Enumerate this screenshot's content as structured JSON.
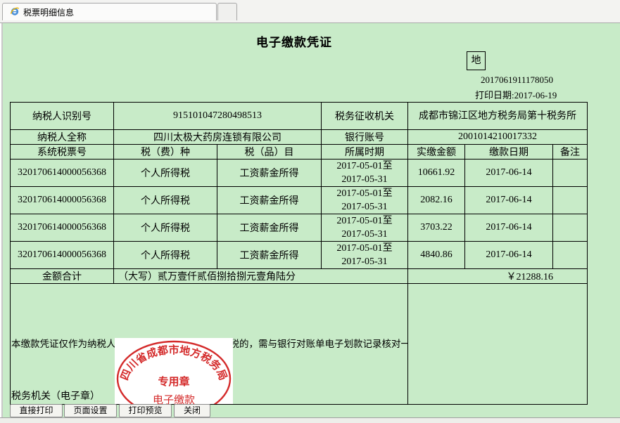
{
  "window": {
    "tab_title": "税票明细信息",
    "icon": "ie-browser-icon"
  },
  "document": {
    "title": "电子缴款凭证",
    "stamp_char": "地",
    "serial": "2017061911178050",
    "print_date": "打印日期:2017-06-19"
  },
  "taxpayer": {
    "id_label": "纳税人识别号",
    "id_value": "915101047280498513",
    "authority_label": "税务征收机关",
    "authority_value": "成都市锦江区地方税务局第十税务所",
    "name_label": "纳税人全称",
    "name_value": "四川太极大药房连锁有限公司",
    "bank_label": "银行账号",
    "bank_value": "2001014210017332"
  },
  "columns": [
    "系统税票号",
    "税（费）种",
    "税（品）目",
    "所属时期",
    "实缴金额",
    "缴款日期",
    "备注"
  ],
  "rows": [
    {
      "ticket": "320170614000056368",
      "tax_type": "个人所得税",
      "item": "工资薪金所得",
      "period_from": "2017-05-01至",
      "period_to": "2017-05-31",
      "amount": "10661.92",
      "date": "2017-06-14",
      "note": ""
    },
    {
      "ticket": "320170614000056368",
      "tax_type": "个人所得税",
      "item": "工资薪金所得",
      "period_from": "2017-05-01至",
      "period_to": "2017-05-31",
      "amount": "2082.16",
      "date": "2017-06-14",
      "note": ""
    },
    {
      "ticket": "320170614000056368",
      "tax_type": "个人所得税",
      "item": "工资薪金所得",
      "period_from": "2017-05-01至",
      "period_to": "2017-05-31",
      "amount": "3703.22",
      "date": "2017-06-14",
      "note": ""
    },
    {
      "ticket": "320170614000056368",
      "tax_type": "个人所得税",
      "item": "工资薪金所得",
      "period_from": "2017-05-01至",
      "period_to": "2017-05-31",
      "amount": "4840.86",
      "date": "2017-06-14",
      "note": ""
    }
  ],
  "total": {
    "label": "金额合计",
    "words": "（大写）贰万壹仟贰佰捌拾捌元壹角陆分",
    "value": "￥21288.16"
  },
  "notice": "本缴款凭证仅作为纳税人记账核算凭证使用，电子缴税的，需与银行对账单电子划款记录核对一致方有效。纳税人如需汇总开具正式完税证明，请凭税务登记证或身份证明到主管税务机关开具。",
  "seal": {
    "ring_text": "四川省成都市地方税务局",
    "center_text": "专用章",
    "bottom_text": "电子缴款",
    "color": "#d42a2a"
  },
  "signer_label": "税务机关（电子章）",
  "buttons": [
    "直接打印",
    "页面设置",
    "打印预览",
    "关闭"
  ],
  "colors": {
    "page_background": "#c8ebc8",
    "seal_red": "#d42a2a"
  }
}
